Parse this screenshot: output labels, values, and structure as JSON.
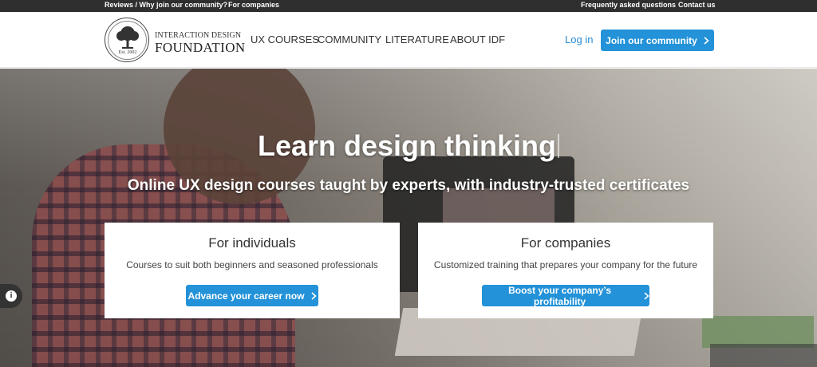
{
  "topbar": {
    "reviews_link": "Reviews / Why join our community?",
    "companies_link": "For companies",
    "faq_link": "Frequently asked questions",
    "contact_link": "Contact us"
  },
  "brand": {
    "line1": "INTERACTION DESIGN",
    "line2": "FOUNDATION",
    "established": "Est. 2002",
    "icon": "tree-seal-logo"
  },
  "nav": {
    "items": [
      {
        "label": "UX COURSES"
      },
      {
        "label": "COMMUNITY"
      },
      {
        "label": "LITERATURE"
      },
      {
        "label": "ABOUT IDF"
      }
    ],
    "login": "Log in",
    "join": "Join our community"
  },
  "hero": {
    "title": "Learn design thinking",
    "subtitle": "Online UX design courses taught by experts, with industry-trusted certificates"
  },
  "cards": {
    "individuals": {
      "title": "For individuals",
      "description": "Courses to suit both beginners and seasoned professionals",
      "button": "Advance your career now"
    },
    "companies": {
      "title": "For companies",
      "description": "Customized training that prepares your company for the future",
      "button": "Boost your company’s profitability"
    }
  },
  "icons": {
    "chevron": "chevron-right-icon",
    "info": "info-icon"
  },
  "colors": {
    "accent": "#2392d8",
    "topbar": "#2f2f2f",
    "link": "#2a8bd6"
  }
}
